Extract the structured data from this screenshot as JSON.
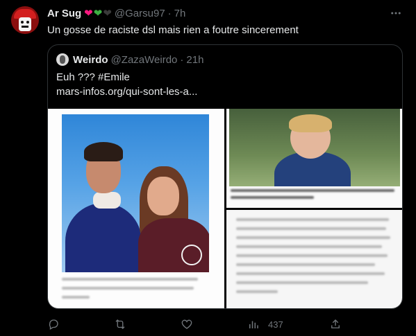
{
  "tweet": {
    "author_name": "Ar Sug",
    "hearts": [
      {
        "glyph": "❤",
        "color": "#f91880"
      },
      {
        "glyph": "❤",
        "color": "#3cb043"
      },
      {
        "glyph": "❤",
        "color": "#3a3a3a"
      }
    ],
    "handle": "@Garsu97",
    "separator": "·",
    "time": "7h",
    "more_icon": "more-horizontal-icon",
    "text": "Un gosse de raciste dsl mais rien a foutre sincerement"
  },
  "quote": {
    "author_name": "Weirdo",
    "handle": "@ZazaWeirdo",
    "separator": "·",
    "time": "21h",
    "text_line1": "Euh ??? #Emile",
    "text_line2": "mars-infos.org/qui-sont-les-a..."
  },
  "actions": {
    "reply_icon": "reply-icon",
    "retweet_icon": "retweet-icon",
    "like_icon": "heart-icon",
    "views_icon": "views-icon",
    "views_count": "437",
    "share_icon": "share-icon"
  },
  "colors": {
    "background": "#000000",
    "text_primary": "#e7e9ea",
    "text_secondary": "#71767b",
    "border": "#2f3336"
  }
}
